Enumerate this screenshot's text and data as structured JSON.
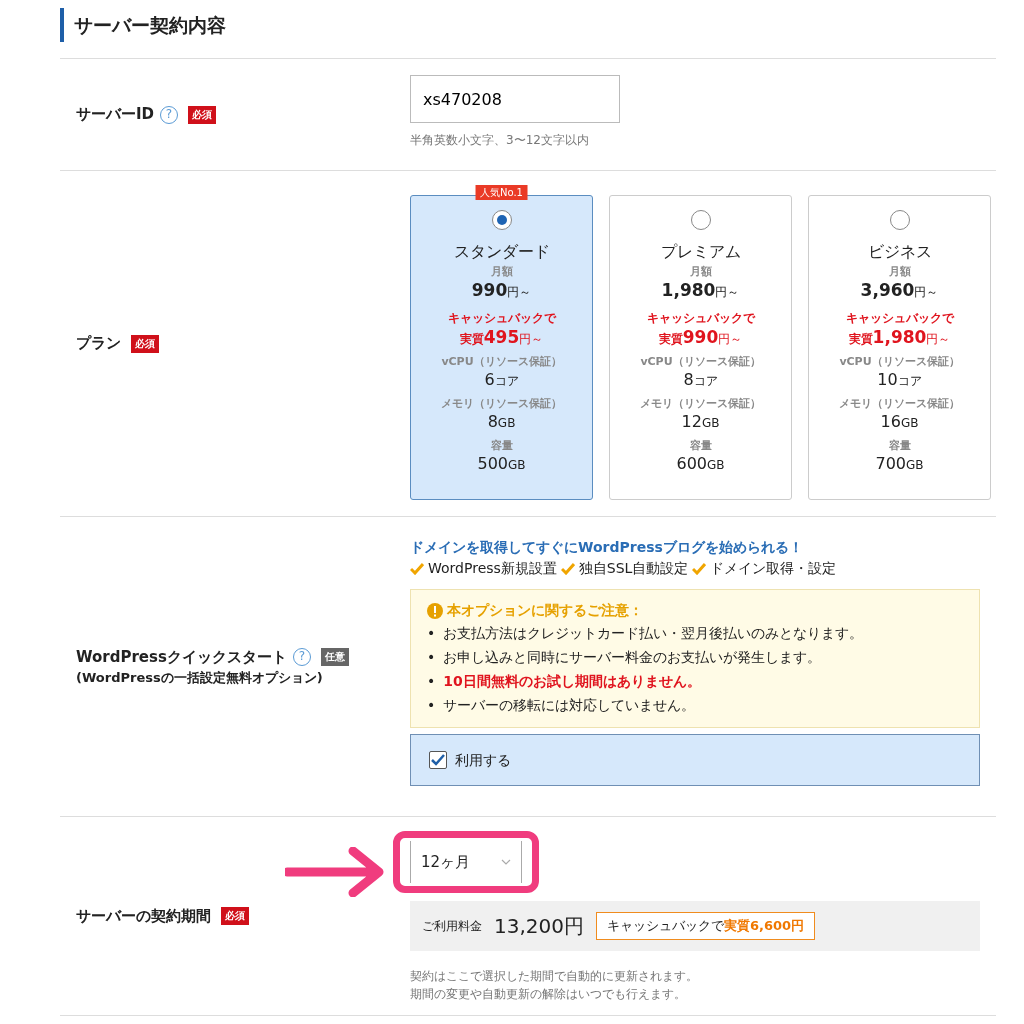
{
  "section_title": "サーバー契約内容",
  "server_id": {
    "label": "サーバーID",
    "help_mark": "?",
    "badge": {
      "kind": "required",
      "text": "必須"
    },
    "value": "xs470208",
    "hint": "半角英数小文字、3〜12文字以内"
  },
  "plan": {
    "label": "プラン",
    "badge": {
      "kind": "required",
      "text": "必須"
    },
    "plans": [
      {
        "ribbon": "人気No.1",
        "selected": true,
        "name": "スタンダード",
        "monthly_label": "月額",
        "price": "990",
        "price_unit": "円～",
        "cashback_label": "キャッシュバックで",
        "real_prefix": "実質",
        "real_price": "495",
        "real_unit": "円～",
        "cpu_label": "vCPU（リソース保証）",
        "cpu": "6",
        "cpu_unit": "コア",
        "mem_label": "メモリ（リソース保証）",
        "mem": "8",
        "mem_unit": "GB",
        "disk_label": "容量",
        "disk": "500",
        "disk_unit": "GB"
      },
      {
        "selected": false,
        "name": "プレミアム",
        "monthly_label": "月額",
        "price": "1,980",
        "price_unit": "円～",
        "cashback_label": "キャッシュバックで",
        "real_prefix": "実質",
        "real_price": "990",
        "real_unit": "円～",
        "cpu_label": "vCPU（リソース保証）",
        "cpu": "8",
        "cpu_unit": "コア",
        "mem_label": "メモリ（リソース保証）",
        "mem": "12",
        "mem_unit": "GB",
        "disk_label": "容量",
        "disk": "600",
        "disk_unit": "GB"
      },
      {
        "selected": false,
        "name": "ビジネス",
        "monthly_label": "月額",
        "price": "3,960",
        "price_unit": "円～",
        "cashback_label": "キャッシュバックで",
        "real_prefix": "実質",
        "real_price": "1,980",
        "real_unit": "円～",
        "cpu_label": "vCPU（リソース保証）",
        "cpu": "10",
        "cpu_unit": "コア",
        "mem_label": "メモリ（リソース保証）",
        "mem": "16",
        "mem_unit": "GB",
        "disk_label": "容量",
        "disk": "700",
        "disk_unit": "GB"
      }
    ]
  },
  "quick_start": {
    "label": "WordPressクイックスタート",
    "help_mark": "?",
    "badge": {
      "kind": "optional",
      "text": "任意"
    },
    "sublabel": "(WordPressの一括設定無料オプション)",
    "intro": "ドメインを取得してすぐにWordPressブログを始められる！",
    "features": [
      "WordPress新規設置",
      "独自SSL自動設定",
      "ドメイン取得・設定"
    ],
    "notice": {
      "title": "本オプションに関するご注意：",
      "items": [
        {
          "bullet": "•",
          "text": "お支払方法はクレジットカード払い・翌月後払いのみとなります。",
          "emphasis": false
        },
        {
          "bullet": "•",
          "text": "お申し込みと同時にサーバー料金のお支払いが発生します。",
          "emphasis": false
        },
        {
          "bullet": "•",
          "text": "10日間無料のお試し期間はありません。",
          "emphasis": true
        },
        {
          "bullet": "•",
          "text": "サーバーの移転には対応していません。",
          "emphasis": false
        }
      ]
    },
    "checkbox": {
      "label": "利用する",
      "checked": true
    }
  },
  "period": {
    "label": "サーバーの契約期間",
    "badge": {
      "kind": "required",
      "text": "必須"
    },
    "select_value": "12ヶ月",
    "highlighted": true,
    "fee_label": "ご利用料金",
    "fee": "13,200円",
    "cashback": "キャッシュバックで**実質6,600円**",
    "notes": [
      "契約はここで選択した期間で自動的に更新されます。",
      "期間の変更や自動更新の解除はいつでも行えます。"
    ]
  }
}
